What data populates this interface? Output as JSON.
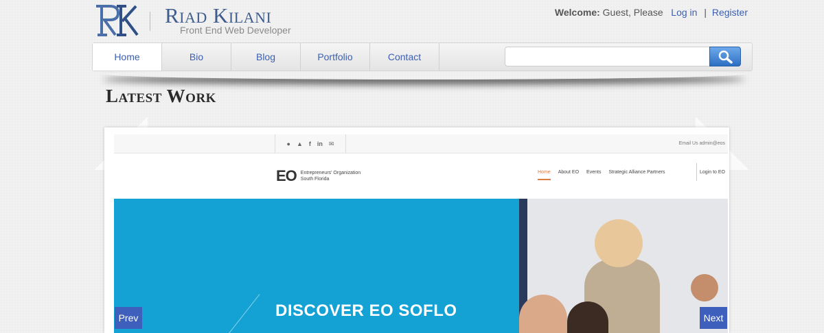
{
  "brand": {
    "name": "Riad Kilani",
    "tagline": "Front End Web Developer",
    "accent": "#3f5d8c"
  },
  "account": {
    "welcome_label": "Welcome:",
    "welcome_text": "Guest, Please",
    "login": "Log in",
    "separator": "|",
    "register": "Register"
  },
  "nav": {
    "items": [
      {
        "label": "Home",
        "active": true
      },
      {
        "label": "Bio"
      },
      {
        "label": "Blog"
      },
      {
        "label": "Portfolio"
      },
      {
        "label": "Contact"
      }
    ],
    "search_placeholder": "",
    "search_icon": "search-icon"
  },
  "section": {
    "title": "Latest Work"
  },
  "slide": {
    "email": "Email Us admin@eos",
    "org_letters": "EO",
    "org_name": "Entrepreneurs' Organization",
    "org_sub": "South Florida",
    "nav": [
      "Home",
      "About EO",
      "Events",
      "Strategic Alliance Partners"
    ],
    "login": "Login to EO",
    "headline": "DISCOVER EO SOFLO",
    "hero_color": "#14a1d3"
  },
  "slider": {
    "prev": "Prev",
    "next": "Next",
    "button_color": "#3f5fbd"
  }
}
